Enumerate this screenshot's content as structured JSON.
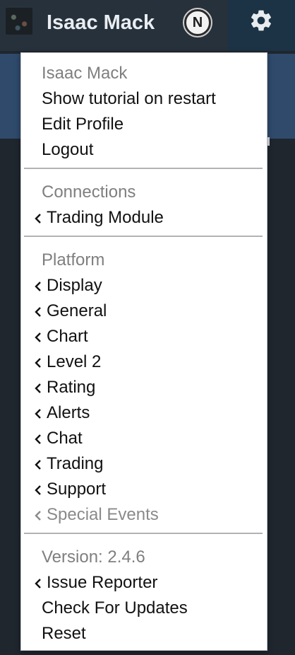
{
  "topbar": {
    "username": "Isaac Mack",
    "badge_letter": "N",
    "avatar_icon": "avatar-image",
    "settings_icon": "gear-icon"
  },
  "menu": {
    "account": {
      "header": "Isaac Mack",
      "items": [
        "Show tutorial on restart",
        "Edit Profile",
        "Logout"
      ]
    },
    "connections": {
      "header": "Connections",
      "items": [
        "Trading Module"
      ]
    },
    "platform": {
      "header": "Platform",
      "items": [
        "Display",
        "General",
        "Chart",
        "Level 2",
        "Rating",
        "Alerts",
        "Chat",
        "Trading",
        "Support",
        "Special Events"
      ]
    },
    "about": {
      "version": "Version: 2.4.6",
      "items": [
        "Issue Reporter",
        "Check For Updates",
        "Reset"
      ]
    }
  },
  "colors": {
    "topbar": "#27313b",
    "gear_bg": "#1b3345",
    "back_panel": "#2f4a6b",
    "menu_bg": "#ffffff",
    "header_text": "#7f7f7f",
    "item_text": "#111111"
  }
}
